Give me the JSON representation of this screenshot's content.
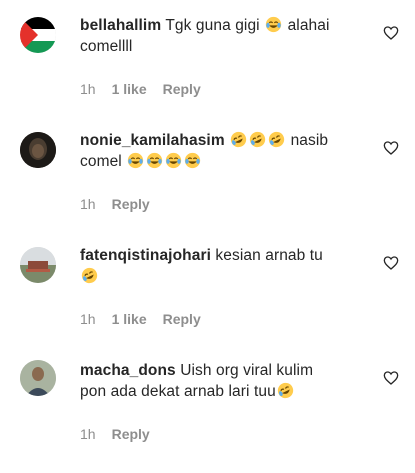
{
  "comments": [
    {
      "username": "bellahallim",
      "text_line1": "Tgk guna gigi",
      "text_after_emoji": "alahai",
      "text_line2": "comellll",
      "emoji": [
        "face-with-tears-of-joy"
      ],
      "time": "1h",
      "likes": "1 like",
      "reply": "Reply",
      "avatar": "palestine-flag"
    },
    {
      "username": "nonie_kamilahasim",
      "text_after_emoji": "nasib",
      "text_line2": "comel",
      "emoji": [
        "rolling-on-floor-laughing",
        "rolling-on-floor-laughing",
        "rolling-on-floor-laughing",
        "face-with-tears-of-joy",
        "face-with-tears-of-joy",
        "face-with-tears-of-joy",
        "face-with-tears-of-joy"
      ],
      "time": "1h",
      "reply": "Reply",
      "avatar": "dark-portrait"
    },
    {
      "username": "fatenqistinajohari",
      "text_line1": "kesian arnab tu",
      "emoji": [
        "rolling-on-floor-laughing"
      ],
      "time": "1h",
      "likes": "1 like",
      "reply": "Reply",
      "avatar": "outdoor-photo"
    },
    {
      "username": "macha_dons",
      "text_line1": "Uish org viral kulim",
      "text_line2": "pon ada dekat arnab lari tuu",
      "emoji": [
        "rolling-on-floor-laughing"
      ],
      "time": "1h",
      "reply": "Reply",
      "avatar": "person-portrait"
    }
  ],
  "colors": {
    "text": "#262626",
    "secondary": "#8e8e8e",
    "emoji_face": "#ffcc4d",
    "flag_red": "#e4312b",
    "flag_green": "#149954"
  }
}
